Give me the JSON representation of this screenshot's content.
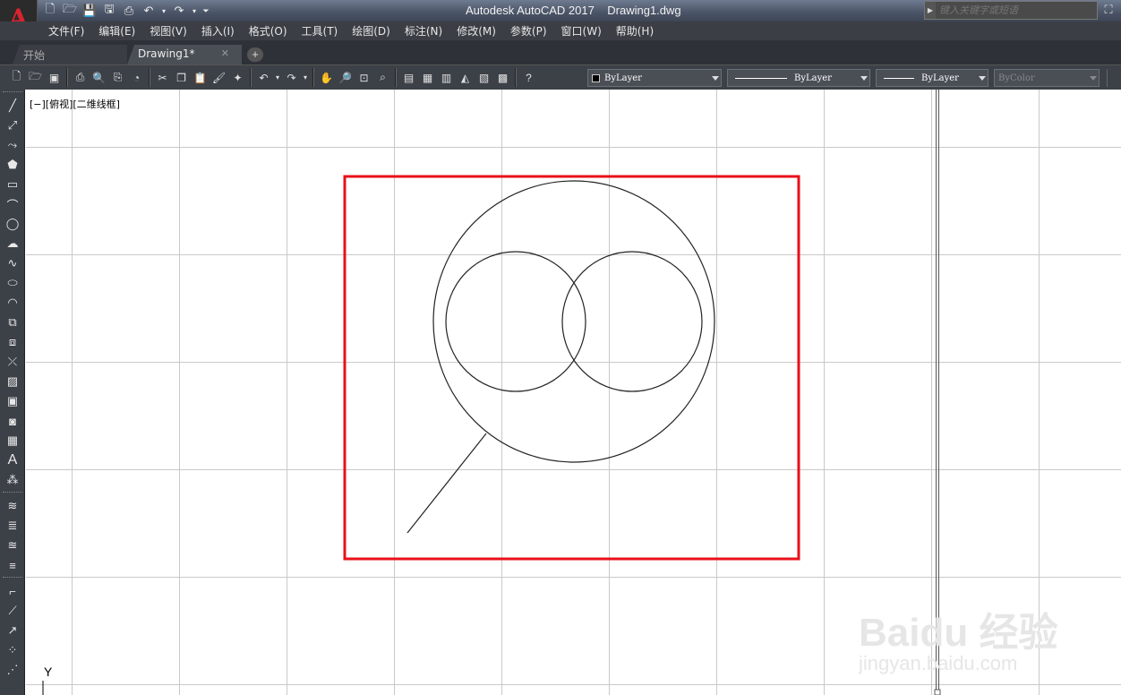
{
  "window": {
    "title": "Autodesk AutoCAD 2017    Drawing1.dwg",
    "app_logo": "A"
  },
  "search": {
    "placeholder": "键入关键字或短语"
  },
  "menu": [
    "文件(F)",
    "编辑(E)",
    "视图(V)",
    "插入(I)",
    "格式(O)",
    "工具(T)",
    "绘图(D)",
    "标注(N)",
    "修改(M)",
    "参数(P)",
    "窗口(W)",
    "帮助(H)"
  ],
  "tabs": {
    "start": "开始",
    "drawing": "Drawing1*",
    "close": "✕",
    "add": "+"
  },
  "properties": {
    "color": "ByLayer",
    "linetype": "ByLayer",
    "lineweight": "ByLayer",
    "plotstyle": "ByColor"
  },
  "canvas": {
    "view_label": "[−][俯视][二维线框]",
    "ucs_y": "Y",
    "highlight_color": "#e8101a"
  },
  "watermark": {
    "logo": "Baidu 经验",
    "url": "jingyan.baidu.com"
  }
}
